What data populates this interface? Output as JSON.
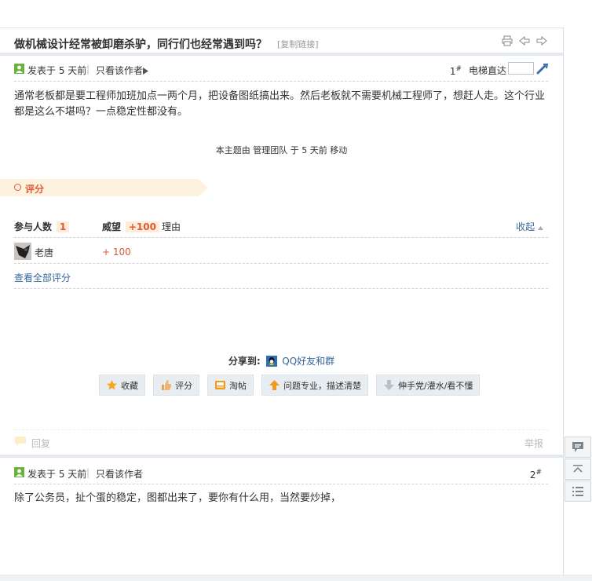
{
  "thread": {
    "title": "做机械设计经常被卸磨杀驴，同行们也经常遇到吗？",
    "copy_link": "[复制链接]"
  },
  "posts": [
    {
      "posted": "发表于 5 天前",
      "only_author": "只看该作者",
      "floor": "1",
      "floor_mark": "#",
      "body": "通常老板都是要工程师加班加点一两个月，把设备图纸搞出来。然后老板就不需要机械工程师了，想赶人走。这个行业都是这么不堪吗？一点稳定性都没有。",
      "moved_note": "本主题由 管理团队 于 5 天前 移动"
    },
    {
      "posted": "发表于 5 天前",
      "only_author": "只看该作者",
      "floor": "2",
      "floor_mark": "#",
      "body": "除了公务员，扯个蛋的稳定，图都出来了，要你有什么用，当然要炒掉，"
    }
  ],
  "elevator": {
    "label": "电梯直达",
    "value": ""
  },
  "rating": {
    "banner": "评分",
    "participants_label": "参与人数",
    "participants_count": "1",
    "prestige_label": "威望",
    "prestige_total": "+100",
    "reason_label": "理由",
    "collapse_label": "收起",
    "rows": [
      {
        "user": "老唐",
        "score": "+ 100"
      }
    ],
    "view_all": "查看全部评分"
  },
  "share": {
    "label": "分享到:",
    "qq": "QQ好友和群"
  },
  "actions": [
    {
      "name": "favorite",
      "label": "收藏",
      "icon": "star-icon"
    },
    {
      "name": "rate",
      "label": "评分",
      "icon": "thumbs-up-icon"
    },
    {
      "name": "taotie",
      "label": "淘帖",
      "icon": "tray-icon"
    },
    {
      "name": "support",
      "label": "问题专业，描述清楚",
      "icon": "arrow-up-icon"
    },
    {
      "name": "oppose",
      "label": "伸手党/灌水/看不懂",
      "icon": "arrow-down-icon"
    }
  ],
  "reply": {
    "label": "回复",
    "report": "举报"
  },
  "colors": {
    "accent": "#e05b33",
    "link": "#336699",
    "banner": "#fdf2e0"
  }
}
